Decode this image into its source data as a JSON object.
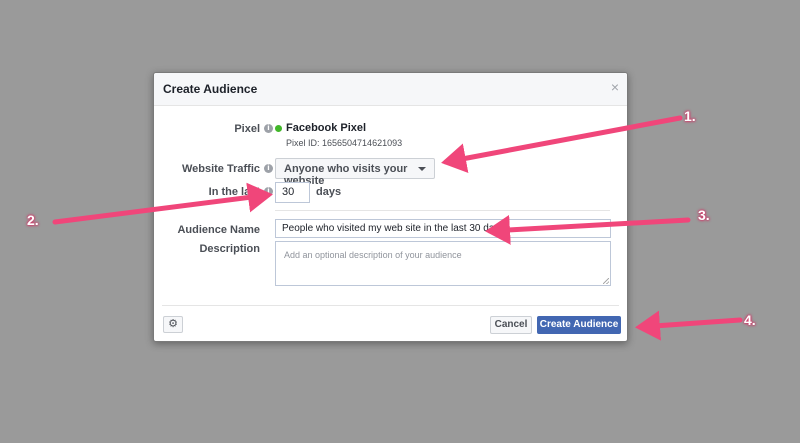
{
  "dialog": {
    "title": "Create Audience",
    "close_glyph": "×"
  },
  "form": {
    "pixel_label": "Pixel",
    "pixel_name": "Facebook Pixel",
    "pixel_id": "Pixel ID: 1656504714621093",
    "traffic_label": "Website Traffic",
    "traffic_value": "Anyone who visits your website",
    "in_last_label": "In the last",
    "days_value": "30",
    "days_unit": "days",
    "audience_name_label": "Audience Name",
    "audience_name_value": "People who visited my web site in the last 30 days",
    "description_label": "Description",
    "description_placeholder": "Add an optional description of your audience",
    "info_glyph": "i"
  },
  "footer": {
    "settings_glyph": "⚙",
    "cancel_label": "Cancel",
    "create_label": "Create Audience"
  },
  "annotations": {
    "labels": [
      "1.",
      "2.",
      "3.",
      "4."
    ],
    "arrow_color": "#f0467a"
  },
  "colors": {
    "backdrop": "#9a9a9a",
    "primary_button": "#4267b2",
    "status_dot": "#42b72a"
  }
}
